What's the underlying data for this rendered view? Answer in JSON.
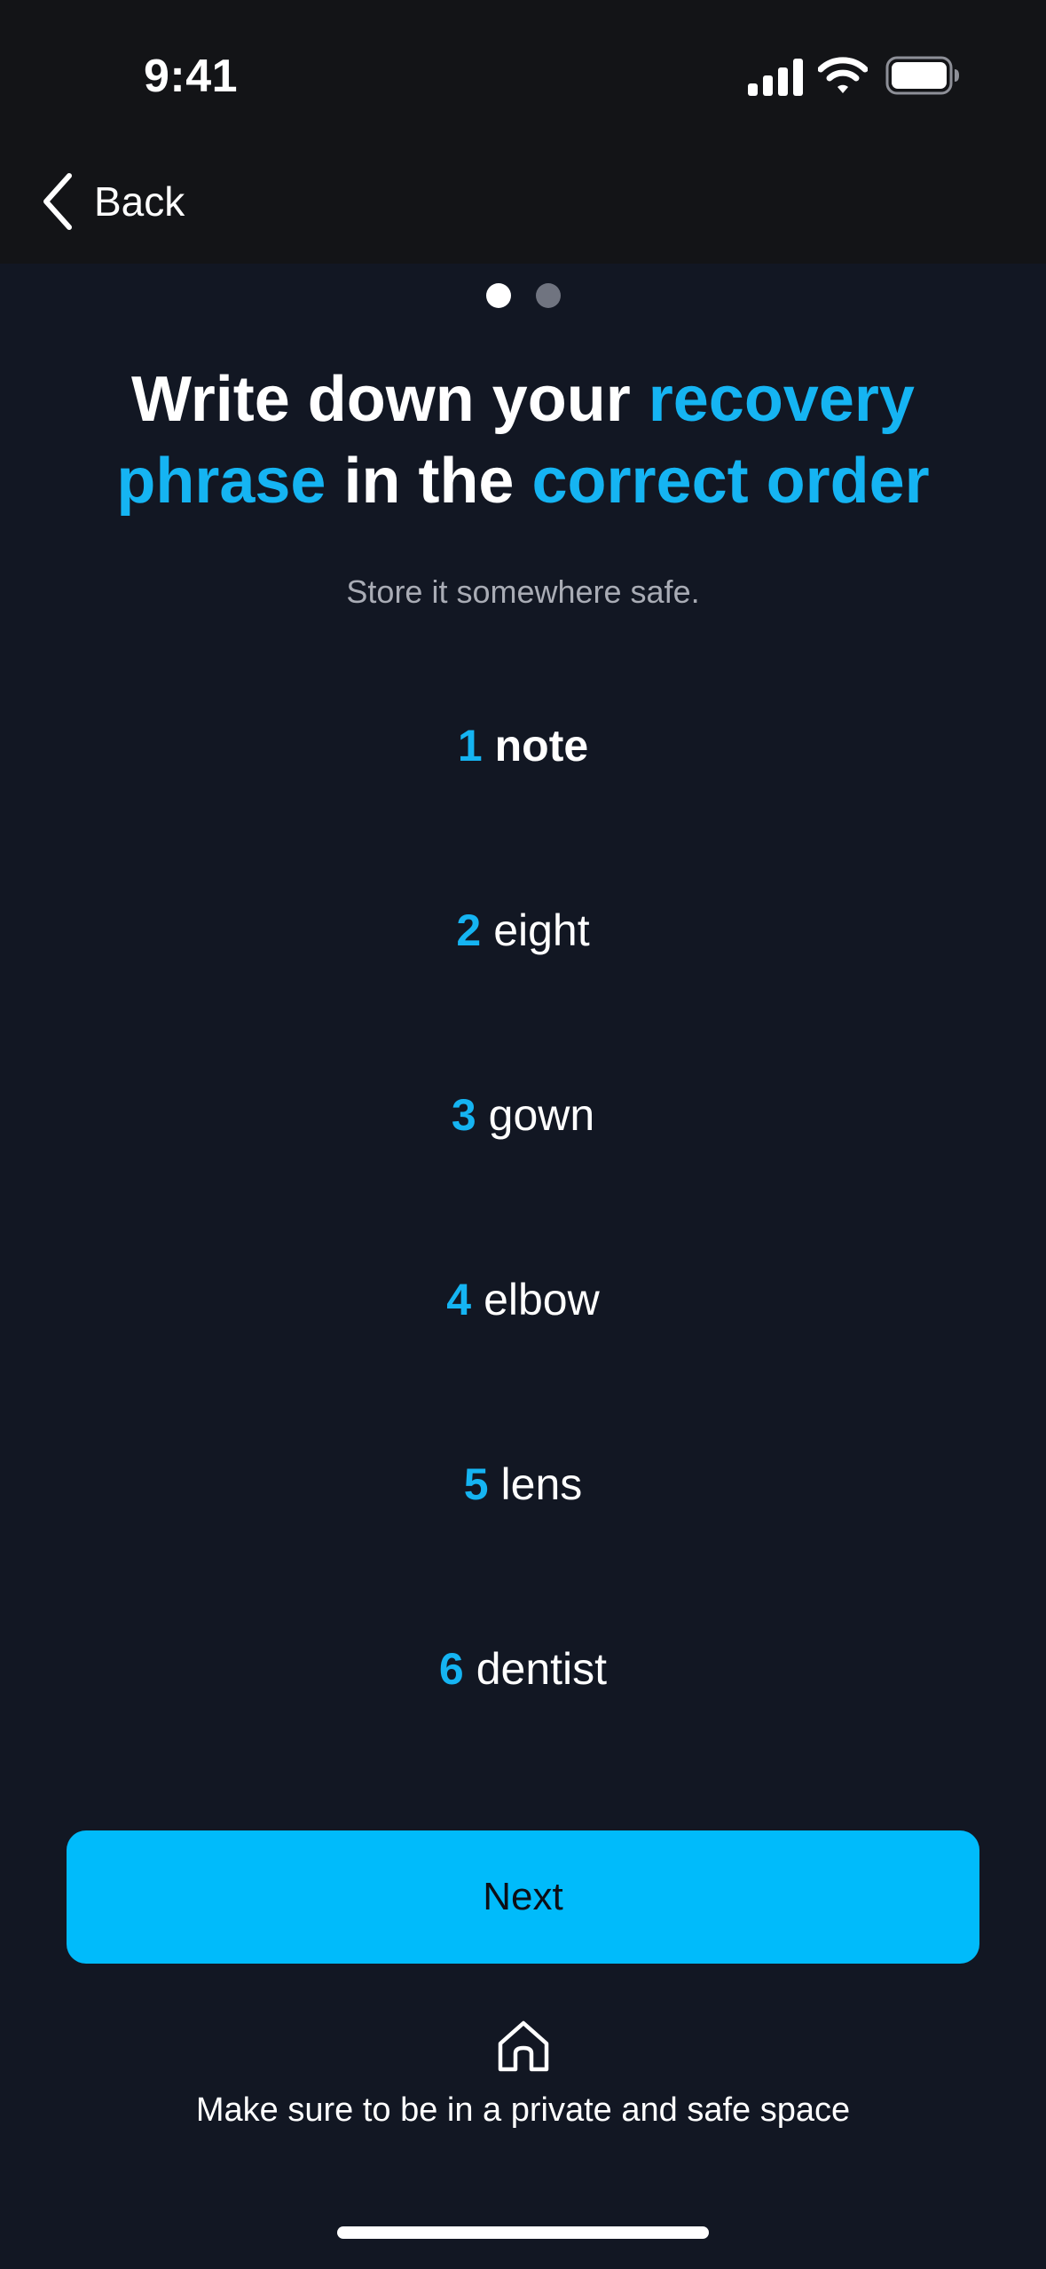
{
  "status_bar": {
    "time": "9:41"
  },
  "nav": {
    "back_label": "Back"
  },
  "pager": {
    "total_pages": 2,
    "current_page": 1
  },
  "headline": {
    "part1": "Write down your ",
    "part2": "recovery phrase",
    "part3": " in the ",
    "part4": "correct order"
  },
  "subtitle": "Store it somewhere safe.",
  "words": [
    {
      "num": "1",
      "word": "note"
    },
    {
      "num": "2",
      "word": "eight"
    },
    {
      "num": "3",
      "word": "gown"
    },
    {
      "num": "4",
      "word": "elbow"
    },
    {
      "num": "5",
      "word": "lens"
    },
    {
      "num": "6",
      "word": "dentist"
    }
  ],
  "next_button_label": "Next",
  "footer": {
    "icon": "home-icon",
    "note": "Make sure to be in a private and safe space"
  },
  "colors": {
    "background": "#121723",
    "top_band": "#131417",
    "accent": "#15b4f2",
    "button": "#00bbfb",
    "subtitle": "#a9acb5"
  }
}
